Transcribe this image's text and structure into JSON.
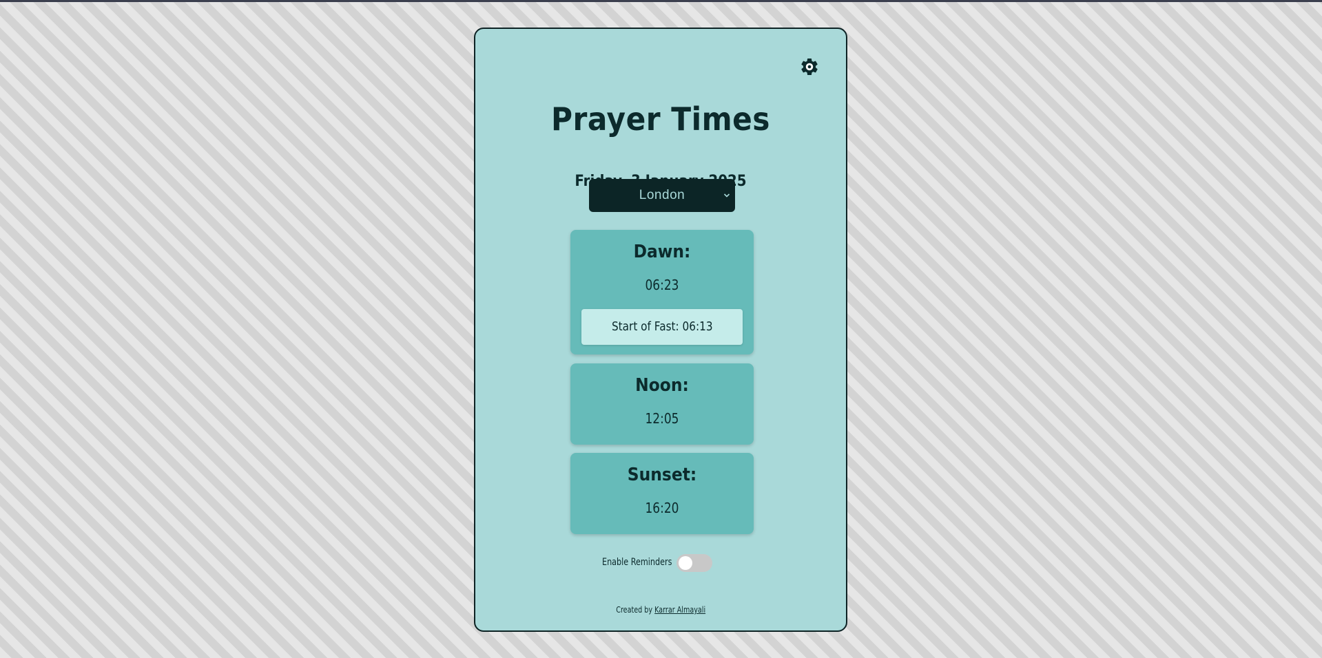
{
  "app": {
    "title": "Prayer Times",
    "date": "Friday, 3 January 2025"
  },
  "settings": {
    "icon": "gear-icon"
  },
  "city_select": {
    "selected": "London",
    "icon": "chevron-down-icon"
  },
  "prayers": [
    {
      "label": "Dawn:",
      "time": "06:23",
      "note": "Start of Fast: 06:13"
    },
    {
      "label": "Noon:",
      "time": "12:05"
    },
    {
      "label": "Sunset:",
      "time": "16:20"
    }
  ],
  "reminders": {
    "label": "Enable Reminders",
    "enabled": false
  },
  "footer": {
    "prefix": "Created by",
    "author": "Karrar Almayali"
  },
  "colors": {
    "card_background": "#a9d9d9",
    "prayer_card": "#66bbb9",
    "highlight_box": "#c5ecea",
    "select_background": "#0c2526",
    "text": "#0c2a2c",
    "toggle_off": "#c8c8c8"
  }
}
